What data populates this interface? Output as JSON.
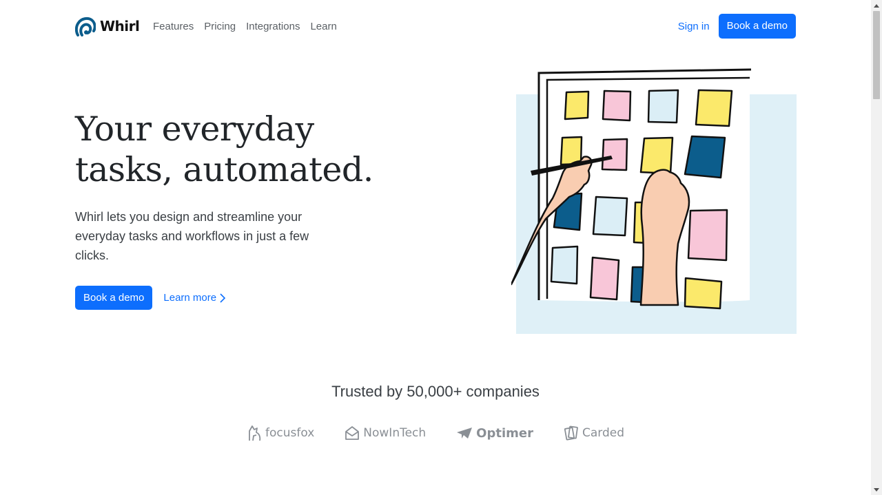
{
  "nav": {
    "brand": "Whirl",
    "links": [
      "Features",
      "Pricing",
      "Integrations",
      "Learn"
    ],
    "sign_in": "Sign in",
    "cta": "Book a demo"
  },
  "hero": {
    "title_line1": "Your everyday",
    "title_line2": "tasks, automated.",
    "lead": "Whirl lets you design and streamline your everyday tasks and workflows in just a few clicks.",
    "primary_cta": "Book a demo",
    "secondary_cta": "Learn more"
  },
  "trust": {
    "title": "Trusted by 50,000+ companies",
    "logos": [
      {
        "name": "focusfox",
        "icon": "fox-icon"
      },
      {
        "name": "NowInTech",
        "icon": "envelope-icon"
      },
      {
        "name": "Optimer",
        "icon": "paper-plane-icon"
      },
      {
        "name": "Carded",
        "icon": "cards-icon"
      }
    ]
  },
  "colors": {
    "accent": "#0d6efd",
    "text": "#212529",
    "muted": "#8a8f95",
    "illustration_bg": "#dff0f7",
    "note_yellow": "#fbe96b",
    "note_pink": "#f8c6d8",
    "note_lightblue": "#dbeef6",
    "note_navy": "#0c5d8c",
    "skin": "#f9cdb1"
  }
}
